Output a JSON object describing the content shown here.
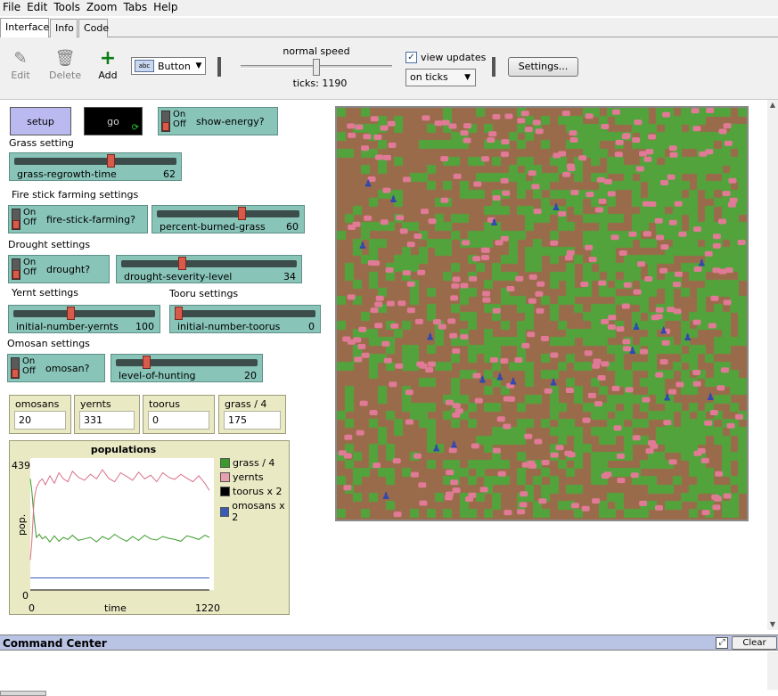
{
  "menu": [
    "File",
    "Edit",
    "Tools",
    "Zoom",
    "Tabs",
    "Help"
  ],
  "tabs": [
    "Interface",
    "Info",
    "Code"
  ],
  "toolbar": {
    "edit_label": "Edit",
    "delete_label": "Delete",
    "add_label": "Add",
    "widget_type": "Button",
    "speed_label": "normal speed",
    "speed_value": 0.5,
    "ticks_label": "ticks: 1190",
    "view_updates_label": "view updates",
    "view_updates_checked": true,
    "update_mode": "on ticks",
    "settings_label": "Settings..."
  },
  "buttons": {
    "setup": "setup",
    "go": "go"
  },
  "sections": {
    "grass": "Grass setting",
    "fire": "Fire stick farming settings",
    "drought": "Drought settings",
    "yernt": "Yernt settings",
    "tooru": "Tooru settings",
    "omosan": "Omosan settings"
  },
  "switches": {
    "show_energy": {
      "on": "On",
      "off": "Off",
      "name": "show-energy?"
    },
    "fire_stick": {
      "on": "On",
      "off": "Off",
      "name": "fire-stick-farming?"
    },
    "drought": {
      "on": "On",
      "off": "Off",
      "name": "drought?"
    },
    "omosan": {
      "on": "On",
      "off": "Off",
      "name": "omosan?"
    }
  },
  "sliders": {
    "grass_regrowth": {
      "name": "grass-regrowth-time",
      "value": "62",
      "fraction": 0.6
    },
    "percent_burned": {
      "name": "percent-burned-grass",
      "value": "60",
      "fraction": 0.6
    },
    "drought_severity": {
      "name": "drought-severity-level",
      "value": "34",
      "fraction": 0.34
    },
    "initial_yernts": {
      "name": "initial-number-yernts",
      "value": "100",
      "fraction": 0.4
    },
    "initial_toorus": {
      "name": "initial-number-toorus",
      "value": "0",
      "fraction": 0.0
    },
    "level_hunting": {
      "name": "level-of-hunting",
      "value": "20",
      "fraction": 0.2
    }
  },
  "monitors": {
    "omosans": {
      "name": "omosans",
      "value": "20"
    },
    "yernts": {
      "name": "yernts",
      "value": "331"
    },
    "toorus": {
      "name": "toorus",
      "value": "0"
    },
    "grass": {
      "name": "grass / 4",
      "value": "175"
    }
  },
  "chart_data": {
    "type": "line",
    "title": "populations",
    "xlabel": "time",
    "ylabel": "pop.",
    "xlim": [
      0,
      1220
    ],
    "ylim": [
      0,
      439
    ],
    "x_tick_labels": [
      "0",
      "1220"
    ],
    "y_tick_labels": [
      "0",
      "439"
    ],
    "series": [
      {
        "name": "grass / 4",
        "color": "#3a9b2a",
        "x": [
          0,
          10,
          25,
          40,
          60,
          80,
          100,
          130,
          160,
          190,
          220,
          250,
          280,
          320,
          360,
          400,
          440,
          480,
          520,
          560,
          600,
          640,
          680,
          720,
          760,
          800,
          840,
          880,
          920,
          960,
          1000,
          1040,
          1080,
          1120,
          1160,
          1190
        ],
        "values": [
          370,
          330,
          240,
          175,
          185,
          170,
          178,
          160,
          180,
          162,
          175,
          168,
          182,
          165,
          170,
          175,
          160,
          178,
          168,
          185,
          172,
          162,
          178,
          165,
          182,
          170,
          166,
          178,
          172,
          168,
          162,
          180,
          175,
          168,
          182,
          175
        ]
      },
      {
        "name": "yernts",
        "color": "#d9708a",
        "x": [
          0,
          10,
          25,
          40,
          60,
          80,
          100,
          130,
          160,
          190,
          220,
          250,
          280,
          320,
          360,
          400,
          440,
          480,
          520,
          560,
          600,
          640,
          680,
          720,
          760,
          800,
          840,
          880,
          920,
          960,
          1000,
          1040,
          1080,
          1120,
          1160,
          1190
        ],
        "values": [
          100,
          160,
          300,
          340,
          360,
          370,
          350,
          380,
          355,
          390,
          370,
          360,
          395,
          375,
          365,
          385,
          370,
          400,
          372,
          360,
          390,
          378,
          365,
          392,
          370,
          382,
          360,
          390,
          375,
          368,
          385,
          372,
          360,
          380,
          355,
          331
        ]
      },
      {
        "name": "toorus x 2",
        "color": "#000000",
        "x": [
          0,
          1190
        ],
        "values": [
          0,
          0
        ]
      },
      {
        "name": "omosans x 2",
        "color": "#3a5bb5",
        "x": [
          0,
          1190
        ],
        "values": [
          40,
          40
        ]
      }
    ]
  },
  "world": {
    "grass_color": "#52a33b",
    "soil_color": "#9a6b4b",
    "yernt_color": "#e07a96",
    "omosan_color": "#3248b0"
  },
  "command_center": {
    "title": "Command Center",
    "clear_label": "Clear"
  }
}
